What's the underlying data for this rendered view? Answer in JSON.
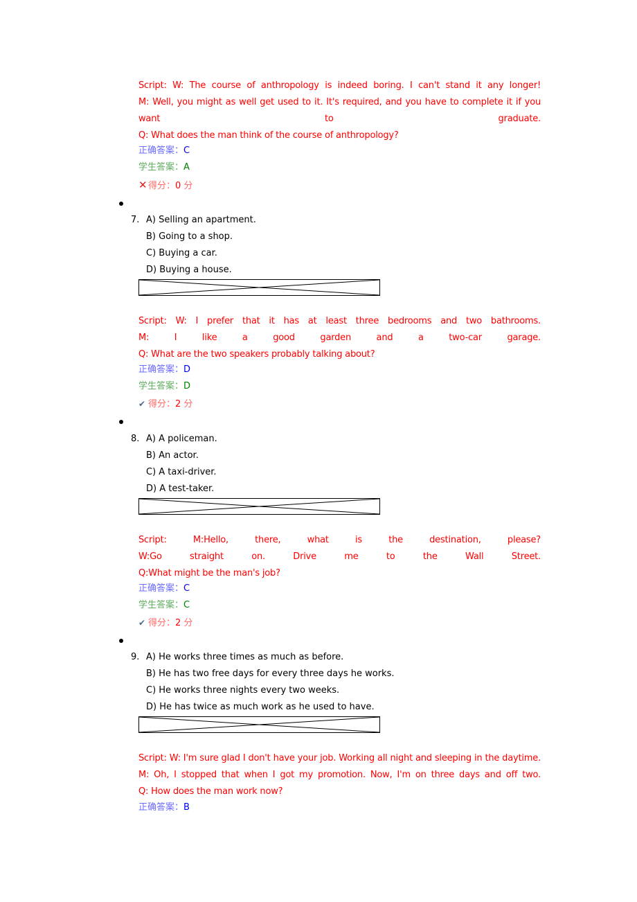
{
  "labels": {
    "correct_answer": "正确答案：",
    "student_answer": "学生答案：",
    "score": "得分：",
    "score_unit": " 分"
  },
  "icons": {
    "wrong": "✕",
    "right": "✔"
  },
  "questions": [
    {
      "number": "",
      "script_lines": [
        "Script: W: The course of anthropology is indeed boring. I can't stand it any longer!",
        "M: Well, you might as well get used to it. It's required, and you have to complete it if you",
        "want to graduate.",
        "Q: What does the man think of the course of anthropology?"
      ],
      "correct_answer": "C",
      "student_answer": "A",
      "score": "0",
      "result": "wrong"
    },
    {
      "number": "7.",
      "options": [
        "A) Selling an apartment.",
        "B) Going to a shop.",
        "C) Buying a car.",
        "D) Buying a house."
      ],
      "script_lines": [
        "Script: W: I prefer that it has at least three bedrooms and two bathrooms.",
        "M: I like a good garden and a two-car garage.",
        "Q: What are the two speakers probably talking about?"
      ],
      "correct_answer": "D",
      "student_answer": "D",
      "score": "2",
      "result": "right"
    },
    {
      "number": "8.",
      "options": [
        "A) A policeman.",
        "B) An actor.",
        "C) A taxi-driver.",
        "D) A test-taker."
      ],
      "script_lines": [
        "Script: M:Hello, there, what is the destination, please?",
        "W:Go straight on. Drive me to the Wall Street.",
        "Q:What might be the man's job?"
      ],
      "correct_answer": "C",
      "student_answer": "C",
      "score": "2",
      "result": "right"
    },
    {
      "number": "9.",
      "options": [
        "A) He works three times as much as before.",
        "B) He has two free days for every three days he works.",
        "C) He works three nights every two weeks.",
        "D) He has twice as much work as he used to have."
      ],
      "script_lines": [
        "Script: W: I'm sure glad I don't have your job. Working all night and sleeping in the daytime.",
        "M: Oh, I stopped that when I got my promotion. Now, I'm on three days and off two.",
        "Q: How does the man work now?"
      ],
      "correct_answer": "B"
    }
  ]
}
